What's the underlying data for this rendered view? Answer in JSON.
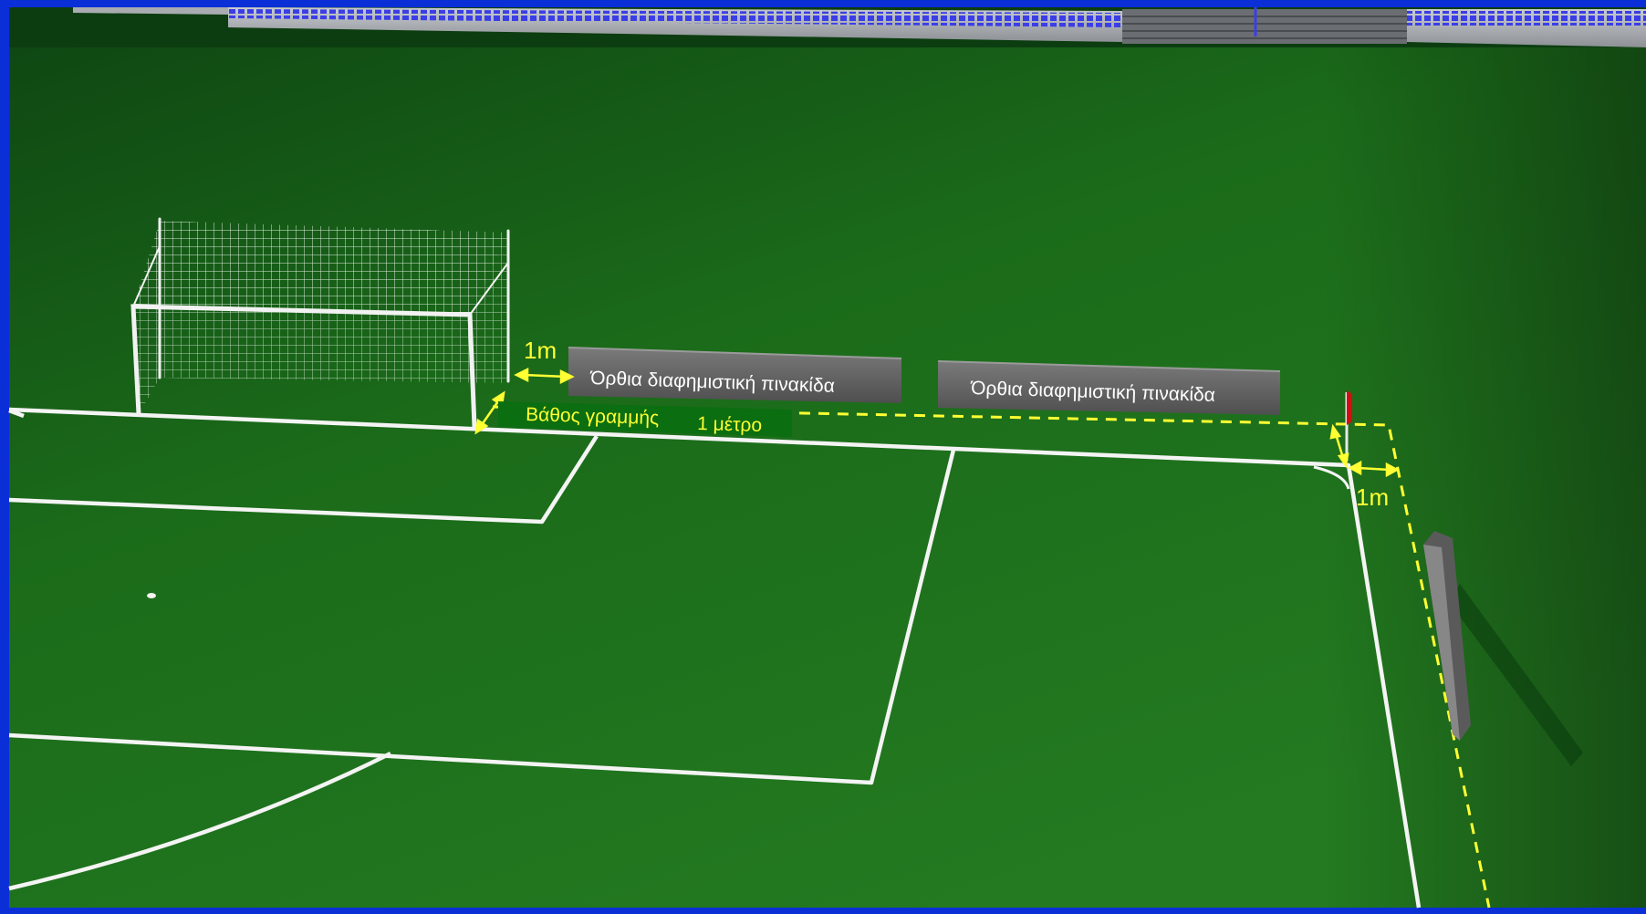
{
  "diagram": {
    "labels": {
      "goal_gap": "1m",
      "board_1": "Όρθια διαφημιστική πινακίδα",
      "board_2": "Όρθια διαφημιστική πινακίδα",
      "line_depth": "Βάθος γραμμής",
      "line_depth_value": "1 μέτρο",
      "corner_gap": "1m"
    },
    "colors": {
      "frame": "#0a2fd6",
      "grass": "#1e6e1c",
      "lines": "#ffffff",
      "annotation": "#ffff33",
      "board": "#5f5f5f",
      "label_box": "#0b6e10",
      "flag": "#d01010"
    }
  }
}
